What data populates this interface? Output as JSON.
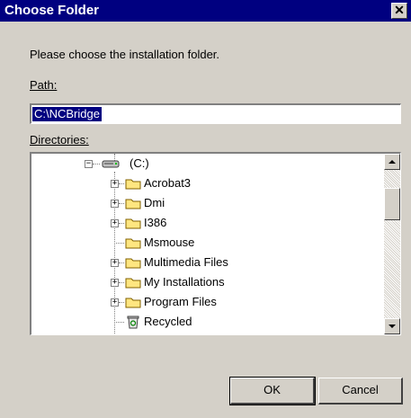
{
  "window": {
    "title": "Choose Folder",
    "close_symbol": "✕"
  },
  "prompt": "Please choose the installation folder.",
  "path": {
    "label": "Path:",
    "value": "C:\\NCBridge"
  },
  "directories": {
    "label": "Directories:",
    "root": {
      "label": "(C:)",
      "icon": "drive-icon"
    },
    "items": [
      {
        "label": "Acrobat3",
        "icon": "folder-icon",
        "expandable": true
      },
      {
        "label": "Dmi",
        "icon": "folder-icon",
        "expandable": true
      },
      {
        "label": "I386",
        "icon": "folder-icon",
        "expandable": true
      },
      {
        "label": "Msmouse",
        "icon": "folder-icon",
        "expandable": false
      },
      {
        "label": "Multimedia Files",
        "icon": "folder-icon",
        "expandable": true
      },
      {
        "label": "My Installations",
        "icon": "folder-icon",
        "expandable": true
      },
      {
        "label": "Program Files",
        "icon": "folder-icon",
        "expandable": true
      },
      {
        "label": "Recycled",
        "icon": "recycle-bin-icon",
        "expandable": false
      }
    ]
  },
  "buttons": {
    "ok": "OK",
    "cancel": "Cancel"
  },
  "colors": {
    "titlebar": "#000080",
    "dialog_bg": "#d4d0c8",
    "selection": "#000080",
    "folder": "#ffe680"
  }
}
